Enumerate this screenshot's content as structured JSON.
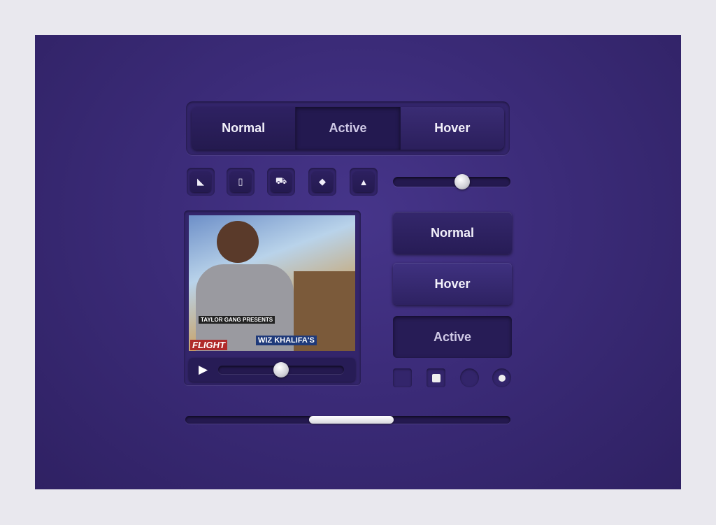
{
  "segmented": {
    "items": [
      {
        "label": "Normal"
      },
      {
        "label": "Active"
      },
      {
        "label": "Hover"
      }
    ],
    "selected": "Active"
  },
  "icon_buttons": [
    {
      "icon": "rss-icon",
      "glyph": "◣"
    },
    {
      "icon": "ipod-icon",
      "glyph": "▯"
    },
    {
      "icon": "cart-icon",
      "glyph": "⛟"
    },
    {
      "icon": "tag-icon",
      "glyph": "◆"
    },
    {
      "icon": "user-icon",
      "glyph": "▲"
    }
  ],
  "slider": {
    "value": 0.59
  },
  "player": {
    "progress": 0.5,
    "play_icon": "▶",
    "album_text": {
      "line1": "TAYLOR GANG PRESENTS",
      "line2": "WIZ KHALIFA'S",
      "line3": "FLIGHT"
    }
  },
  "buttons": [
    {
      "label": "Normal"
    },
    {
      "label": "Hover"
    },
    {
      "label": "Active"
    }
  ],
  "controls": {
    "checkbox_unchecked": false,
    "checkbox_checked": true,
    "radio_unchecked": false,
    "radio_checked": true
  },
  "scrollbar": {
    "thumb_start": 0.38,
    "thumb_end": 0.64
  },
  "colors": {
    "background": "#3b2b78",
    "button": "#2b1f5c",
    "text": "#f2f0fa"
  }
}
